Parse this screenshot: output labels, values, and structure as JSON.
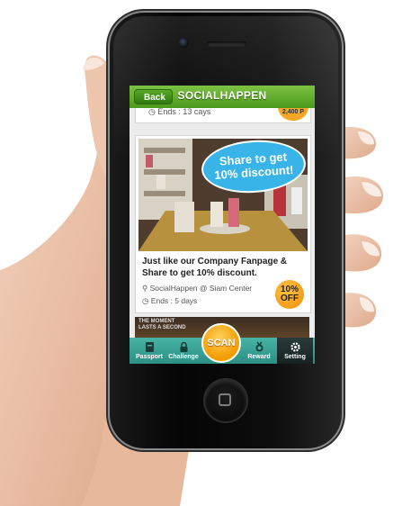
{
  "header": {
    "back_label": "Back",
    "title": "SOCIALHAPPEN"
  },
  "top_item": {
    "ends": "Ends : 13 cays",
    "price": "2,400 P"
  },
  "promo": {
    "bubble_line1": "Share to get",
    "bubble_line2": "10% discount!",
    "title": "Just like our Company Fanpage & Share to get 10% discount.",
    "location": "SocialHappen @ Siam Center",
    "ends": "Ends : 5 days",
    "badge_line1": "10%",
    "badge_line2": "OFF"
  },
  "next_item": {
    "text_line1": "THE MOMENT",
    "text_line2": "LASTS A SECOND"
  },
  "tabbar": {
    "tabs": [
      {
        "label": "Passport",
        "icon": "passport-icon"
      },
      {
        "label": "Challenge",
        "icon": "lock-icon"
      },
      {
        "label": "Reward",
        "icon": "medal-icon"
      },
      {
        "label": "Setting",
        "icon": "gear-icon"
      }
    ],
    "scan_label": "SCAN",
    "active_tab": "Setting"
  },
  "colors": {
    "header_green": "#5aa828",
    "tabbar_teal": "#3aa396",
    "scan_orange": "#f39a00",
    "bubble_blue": "#39b4e8"
  }
}
